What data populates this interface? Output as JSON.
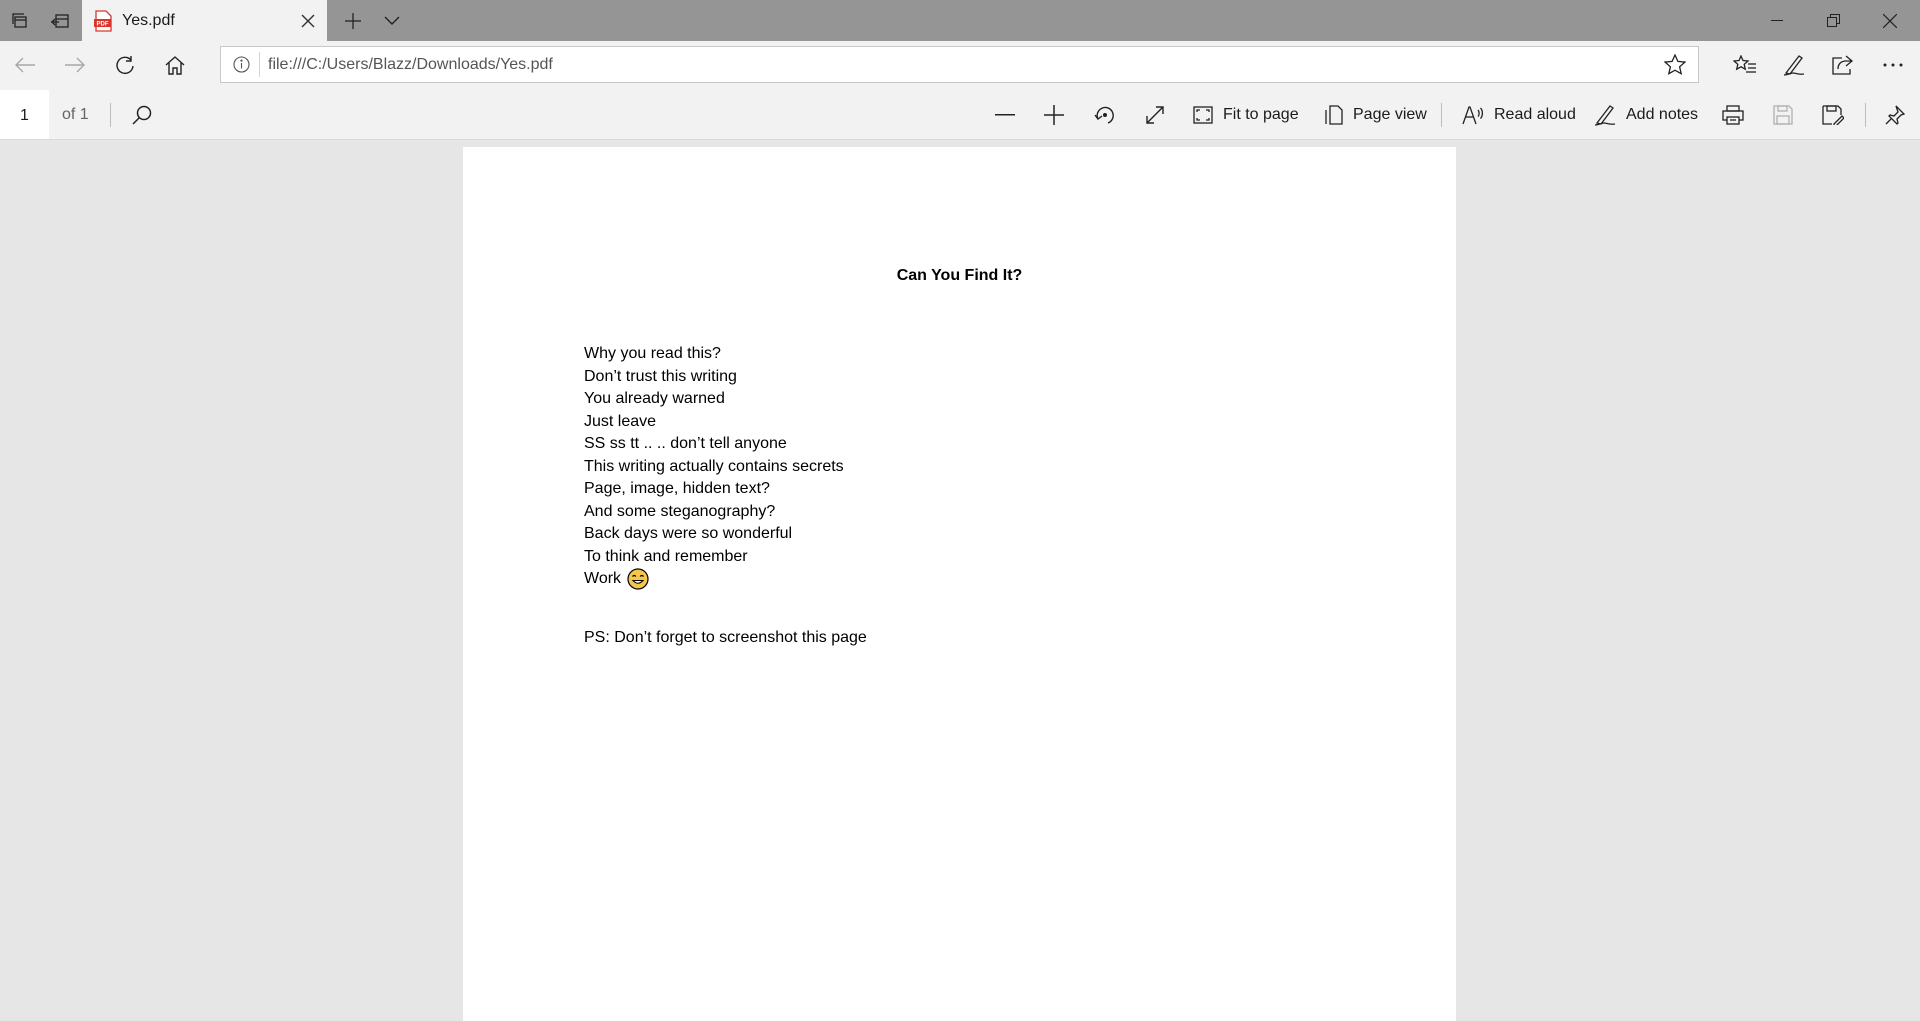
{
  "browser": {
    "tab": {
      "title": "Yes.pdf",
      "favicon": "pdf-file-icon"
    },
    "address_bar": {
      "url": "file:///C:/Users/Blazz/Downloads/Yes.pdf"
    }
  },
  "pdf_toolbar": {
    "page_current": "1",
    "page_total": "of 1",
    "fit_to_page_label": "Fit to page",
    "page_view_label": "Page view",
    "read_aloud_label": "Read aloud",
    "add_notes_label": "Add notes"
  },
  "document": {
    "title": "Can You Find It?",
    "lines": [
      "Why you read this?",
      "Don’t trust this writing",
      "You already warned",
      "Just leave",
      "SS ss tt .. .. don’t tell anyone",
      "This writing actually contains secrets",
      "Page, image, hidden text?",
      "And some steganography?",
      "Back days were so wonderful",
      "To think and remember",
      "Work"
    ],
    "ps": "PS: Don’t forget to screenshot this page"
  },
  "colors": {
    "tabstrip": "#959595",
    "toolbar": "#f2f2f2",
    "viewer_background": "#e6e6e6",
    "pdf_icon_red": "#d9352c"
  }
}
